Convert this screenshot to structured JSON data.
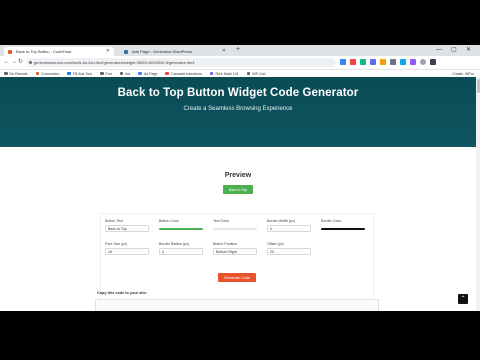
{
  "tabs": [
    {
      "title": "Back to Top Button - CodeFuse",
      "active": true
    },
    {
      "title": "Add Page - Generator WordPress",
      "active": false
    }
  ],
  "window_controls": {
    "minimize": "—",
    "maximize": "▢",
    "close": "✕"
  },
  "toolbar": {
    "back": "←",
    "forward": "→",
    "reload": "↻",
    "url": "generatorsource.com/tools-bx-4fc=/bcf/generators/widget-/5000=5000000 tl/generator.html"
  },
  "bookmarks": [
    "De Remote",
    "Conversion",
    "FB Ads Tool",
    "Fmt",
    "Ind",
    "Ad Page",
    "Canvade Intentions",
    "Ra'e Math 101",
    "WP Cod"
  ],
  "bookmarks_right": "Create, WPro",
  "hero": {
    "title": "Back to Top Button Widget Code Generator",
    "subtitle": "Create a Seamless Browsing Experience"
  },
  "preview": {
    "title": "Preview",
    "button_label": "Back to Top"
  },
  "form": {
    "button_text": {
      "label": "Button Text",
      "value": "Back to Top"
    },
    "button_color": {
      "label": "Button Color",
      "color": "#4caf50"
    },
    "text_color": {
      "label": "Text Color",
      "color": "#ffffff"
    },
    "border_width": {
      "label": "Border Width (px)",
      "value": "0"
    },
    "border_color": {
      "label": "Border Color",
      "color": "#000000"
    },
    "font_size": {
      "label": "Font Size (px)",
      "value": "16"
    },
    "border_radius": {
      "label": "Border Radius (px)",
      "value": "0"
    },
    "button_position": {
      "label": "Button Position",
      "value": "Bottom Right"
    },
    "offset": {
      "label": "Offset (px)",
      "value": "20"
    }
  },
  "generate_label": "Generate Code",
  "copy_label": "Copy this code to your site:",
  "back_to_top_icon": "⌃",
  "colors": {
    "hero_bg": "#0a4b56",
    "generate": "#e8542a",
    "preview_btn": "#4caf50"
  }
}
